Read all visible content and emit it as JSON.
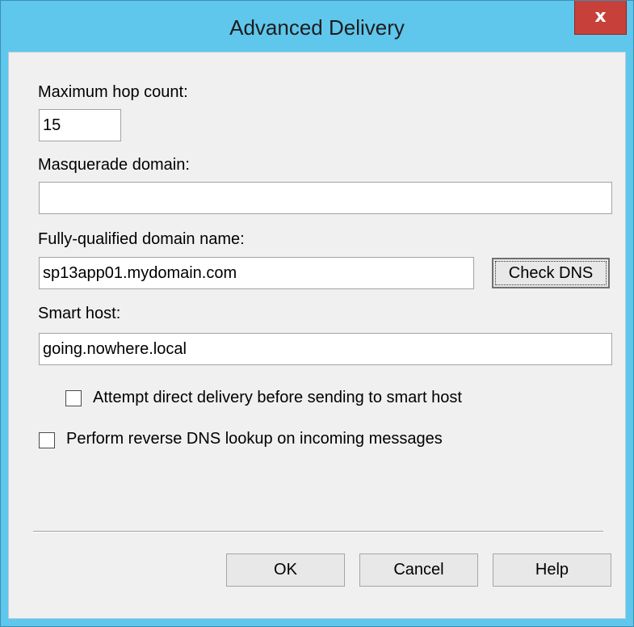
{
  "window": {
    "title": "Advanced Delivery",
    "close_glyph": "x"
  },
  "fields": {
    "max_hop_label": "Maximum hop count:",
    "max_hop_value": "15",
    "masquerade_label": "Masquerade domain:",
    "masquerade_value": "",
    "fqdn_label": "Fully-qualified domain name:",
    "fqdn_value": "sp13app01.mydomain.com",
    "check_dns_label": "Check DNS",
    "smart_host_label": "Smart host:",
    "smart_host_value": "going.nowhere.local"
  },
  "checkboxes": {
    "direct_delivery_label": "Attempt direct delivery before sending to smart host",
    "direct_delivery_checked": false,
    "reverse_dns_label": "Perform reverse DNS lookup on incoming messages",
    "reverse_dns_checked": false
  },
  "buttons": {
    "ok": "OK",
    "cancel": "Cancel",
    "help": "Help"
  }
}
